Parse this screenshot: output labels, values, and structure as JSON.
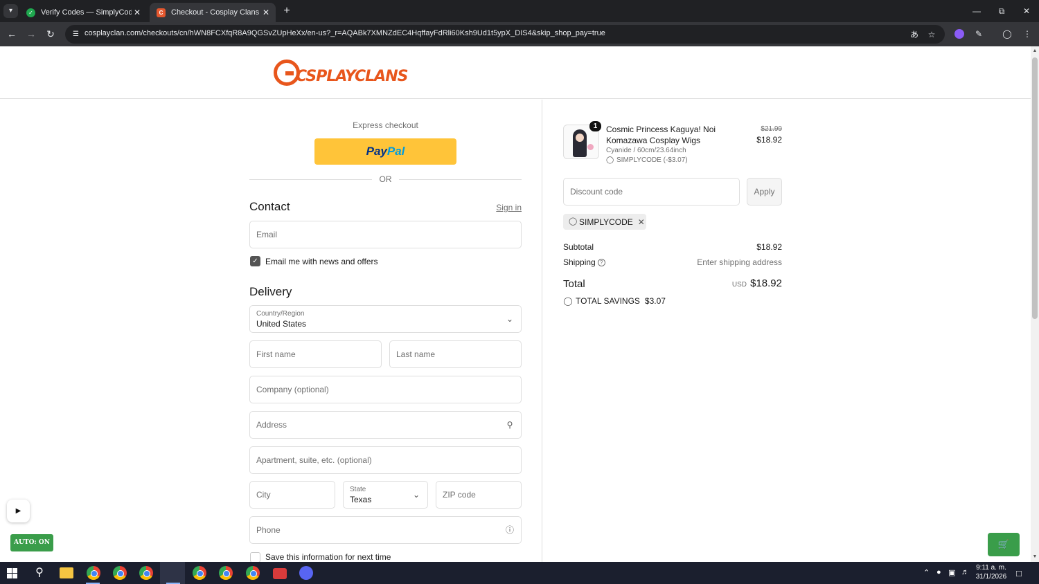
{
  "browser": {
    "tabs": [
      {
        "title": "Verify Codes — SimplyCodes",
        "favicon": "check-icon"
      },
      {
        "title": "Checkout - Cosplay Clans",
        "favicon": "cosplay-clans-icon"
      }
    ],
    "url": "cosplayclan.com/checkouts/cn/hWN8FCXfqR8A9QGSvZUpHeXx/en-us?_r=AQABk7XMNZdEC4HqffayFdRli60Ksh9Ud1t5ypX_DIS4&skip_shop_pay=true"
  },
  "header": {
    "logo_text": "CSPLAYCLANS",
    "logo_color": "#e8561c"
  },
  "express": {
    "label": "Express checkout",
    "paypal_pay": "Pay",
    "paypal_pal": "Pal",
    "paypal_color": "#ffc439",
    "or": "OR"
  },
  "contact": {
    "heading": "Contact",
    "sign_in": "Sign in",
    "email_placeholder": "Email",
    "newsletter_label": "Email me with news and offers",
    "newsletter_checked": true
  },
  "delivery": {
    "heading": "Delivery",
    "country_label": "Country/Region",
    "country_value": "United States",
    "first_name_placeholder": "First name",
    "last_name_placeholder": "Last name",
    "company_placeholder": "Company (optional)",
    "address_placeholder": "Address",
    "apartment_placeholder": "Apartment, suite, etc. (optional)",
    "city_placeholder": "City",
    "state_label": "State",
    "state_value": "Texas",
    "zip_placeholder": "ZIP code",
    "phone_placeholder": "Phone",
    "save_info_label": "Save this information for next time",
    "save_info_checked": false
  },
  "order": {
    "item": {
      "quantity": "1",
      "name": "Cosmic Princess Kaguya! Noi Komazawa Cosplay Wigs",
      "variant": "Cyanide / 60cm/23.64inch",
      "discount": "SIMPLYCODE (-$3.07)",
      "original_price": "$21.99",
      "price": "$18.92"
    },
    "discount_placeholder": "Discount code",
    "apply_label": "Apply",
    "applied_code": "SIMPLYCODE",
    "subtotal_label": "Subtotal",
    "subtotal_value": "$18.92",
    "shipping_label": "Shipping",
    "shipping_value": "Enter shipping address",
    "total_label": "Total",
    "total_currency": "USD",
    "total_value": "$18.92",
    "savings_label": "TOTAL SAVINGS",
    "savings_value": "$3.07"
  },
  "overlays": {
    "auto_label": "AUTO: ON",
    "accent": "#3a9d4a"
  },
  "taskbar": {
    "time": "9:11 a. m.",
    "date": "31/1/2026"
  }
}
